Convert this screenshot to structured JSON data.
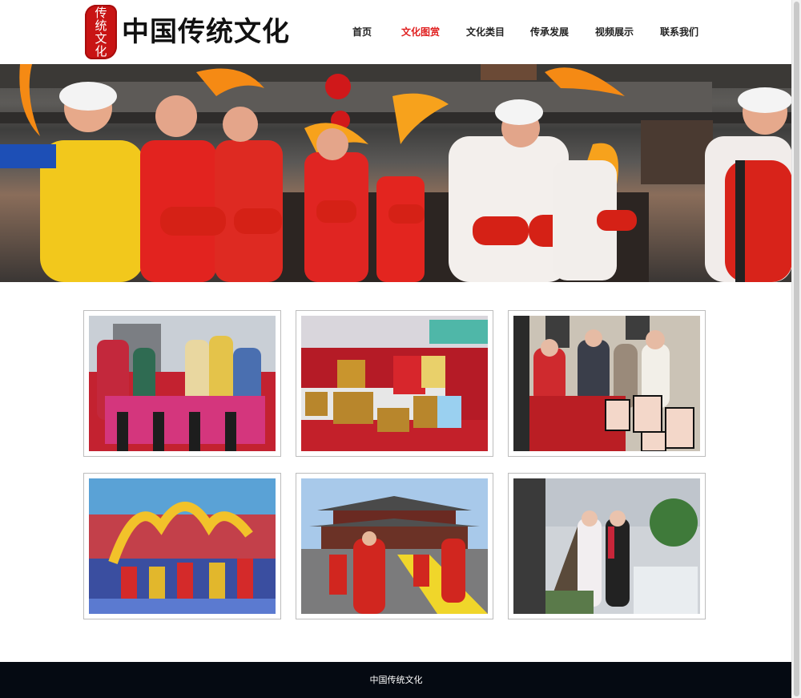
{
  "header": {
    "logo_seal_text": "传统文化",
    "logo_seal_chars": [
      "传",
      "统",
      "文",
      "化"
    ],
    "site_title": "中国传统文化"
  },
  "nav": {
    "items": [
      {
        "label": "首页",
        "active": false
      },
      {
        "label": "文化图赏",
        "active": true
      },
      {
        "label": "文化类目",
        "active": false
      },
      {
        "label": "传承发展",
        "active": false
      },
      {
        "label": "视频展示",
        "active": false
      },
      {
        "label": "联系我们",
        "active": false
      }
    ],
    "active_color": "#e02020"
  },
  "hero": {
    "image": "drum-dance-performers-photo"
  },
  "gallery": {
    "images": [
      "opera-costume-performers-photo",
      "paper-cut-art-exhibition-photo",
      "paper-cutting-craft-photo",
      "dragon-dance-photo",
      "temple-hanfu-ceremony-photo",
      "hanfu-stage-show-photo"
    ]
  },
  "footer": {
    "text": "中国传统文化",
    "background": "#050a12"
  }
}
